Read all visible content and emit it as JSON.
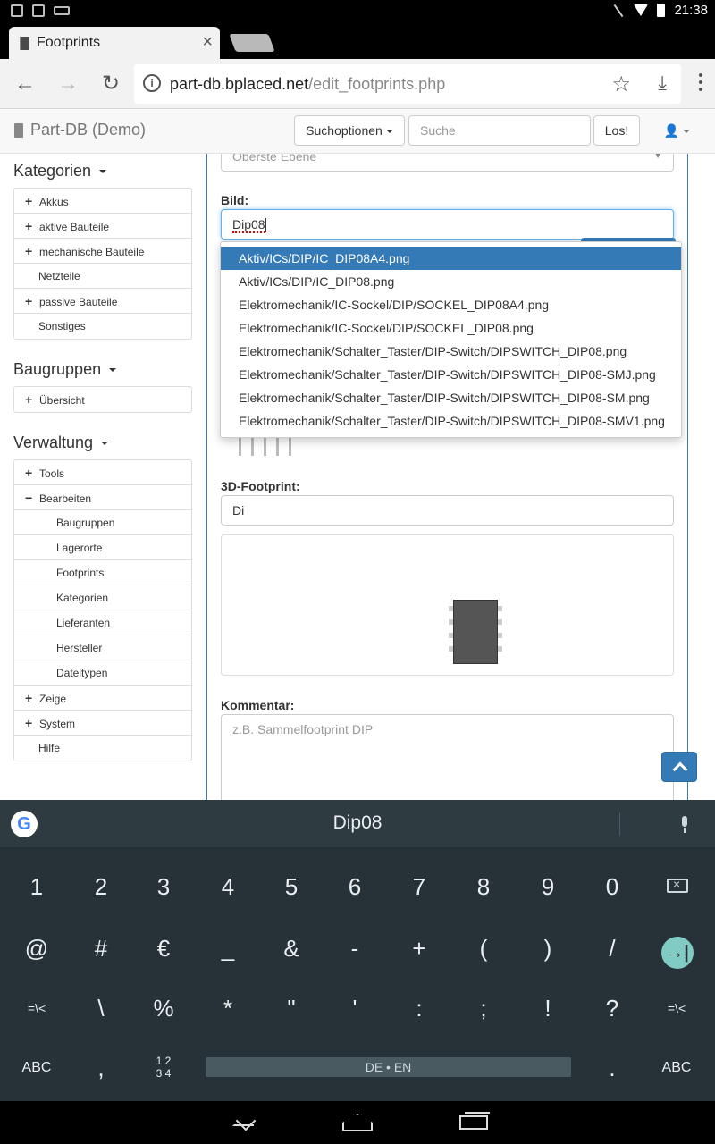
{
  "status_bar": {
    "time": "21:38"
  },
  "tab": {
    "title": "Footprints",
    "close": "×"
  },
  "omnibox": {
    "host": "part-db.bplaced.net",
    "path": "/edit_footprints.php"
  },
  "navbar": {
    "brand": "Part-DB (Demo)",
    "search_options": "Suchoptionen",
    "search_placeholder": "Suche",
    "go": "Los!"
  },
  "sidebar": {
    "categories": {
      "title": "Kategorien",
      "items": [
        "Akkus",
        "aktive Bauteile",
        "mechanische Bauteile",
        "Netzteile",
        "passive Bauteile",
        "Sonstiges"
      ]
    },
    "assemblies": {
      "title": "Baugruppen",
      "items": [
        "Übersicht"
      ]
    },
    "admin": {
      "title": "Verwaltung",
      "tools": "Tools",
      "edit": "Bearbeiten",
      "edit_items": [
        "Baugruppen",
        "Lagerorte",
        "Footprints",
        "Kategorien",
        "Lieferanten",
        "Hersteller",
        "Dateitypen"
      ],
      "show": "Zeige",
      "system": "System",
      "help": "Hilfe"
    }
  },
  "form": {
    "parent_placeholder": "Oberste Ebene",
    "image_label": "Bild:",
    "image_value": "Dip08",
    "footprint3d_label": "3D-Footprint:",
    "footprint3d_value": "Di",
    "comment_label": "Kommentar:",
    "comment_placeholder": "z.B. Sammelfootprint DIP"
  },
  "autocomplete": [
    "Aktiv/ICs/DIP/IC_DIP08A4.png",
    "Aktiv/ICs/DIP/IC_DIP08.png",
    "Elektromechanik/IC-Sockel/DIP/SOCKEL_DIP08A4.png",
    "Elektromechanik/IC-Sockel/DIP/SOCKEL_DIP08.png",
    "Elektromechanik/Schalter_Taster/DIP-Switch/DIPSWITCH_DIP08.png",
    "Elektromechanik/Schalter_Taster/DIP-Switch/DIPSWITCH_DIP08-SMJ.png",
    "Elektromechanik/Schalter_Taster/DIP-Switch/DIPSWITCH_DIP08-SM.png",
    "Elektromechanik/Schalter_Taster/DIP-Switch/DIPSWITCH_DIP08-SMV1.png"
  ],
  "keyboard": {
    "suggestion": "Dip08",
    "row1": [
      "1",
      "2",
      "3",
      "4",
      "5",
      "6",
      "7",
      "8",
      "9",
      "0"
    ],
    "row2": [
      "@",
      "#",
      "€",
      "_",
      "&",
      "-",
      "+",
      "(",
      ")",
      "/"
    ],
    "row3": [
      "=\\<",
      "\\",
      "%",
      "*",
      "\"",
      "'",
      ":",
      ";",
      "!",
      "?",
      "=\\<"
    ],
    "abc": "ABC",
    "comma": ",",
    "frac": "1 2\n3 4",
    "space": "DE • EN",
    "dot": "."
  }
}
